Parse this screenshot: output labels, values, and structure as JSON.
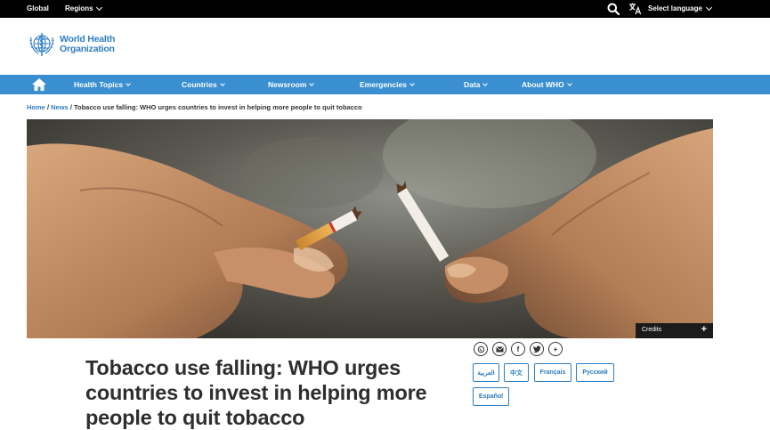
{
  "topbar": {
    "global": "Global",
    "regions": "Regions",
    "select_language": "Select language"
  },
  "logo": {
    "line1": "World Health",
    "line2": "Organization"
  },
  "nav": {
    "items": [
      {
        "label": "Health Topics"
      },
      {
        "label": "Countries"
      },
      {
        "label": "Newsroom"
      },
      {
        "label": "Emergencies"
      },
      {
        "label": "Data"
      },
      {
        "label": "About WHO"
      }
    ]
  },
  "breadcrumb": {
    "home": "Home",
    "news": "News",
    "current": "Tobacco use falling: WHO urges countries to invest in helping more people to quit tobacco",
    "separator": "/"
  },
  "hero": {
    "credits": "Credits",
    "plus": "+"
  },
  "article": {
    "title": "Tobacco use falling: WHO urges countries to invest in helping more people to quit tobacco"
  },
  "share": {
    "icons": [
      "whatsapp-icon",
      "email-icon",
      "facebook-icon",
      "twitter-icon",
      "plus-icon"
    ],
    "facebook": "f",
    "plus": "+"
  },
  "languages": [
    {
      "label": "العربية"
    },
    {
      "label": "中文"
    },
    {
      "label": "Français"
    },
    {
      "label": "Русский"
    },
    {
      "label": "Español"
    }
  ],
  "colors": {
    "brand_blue": "#3a8fd0",
    "link_blue": "#2f7ec2",
    "top_bar": "#000000"
  }
}
